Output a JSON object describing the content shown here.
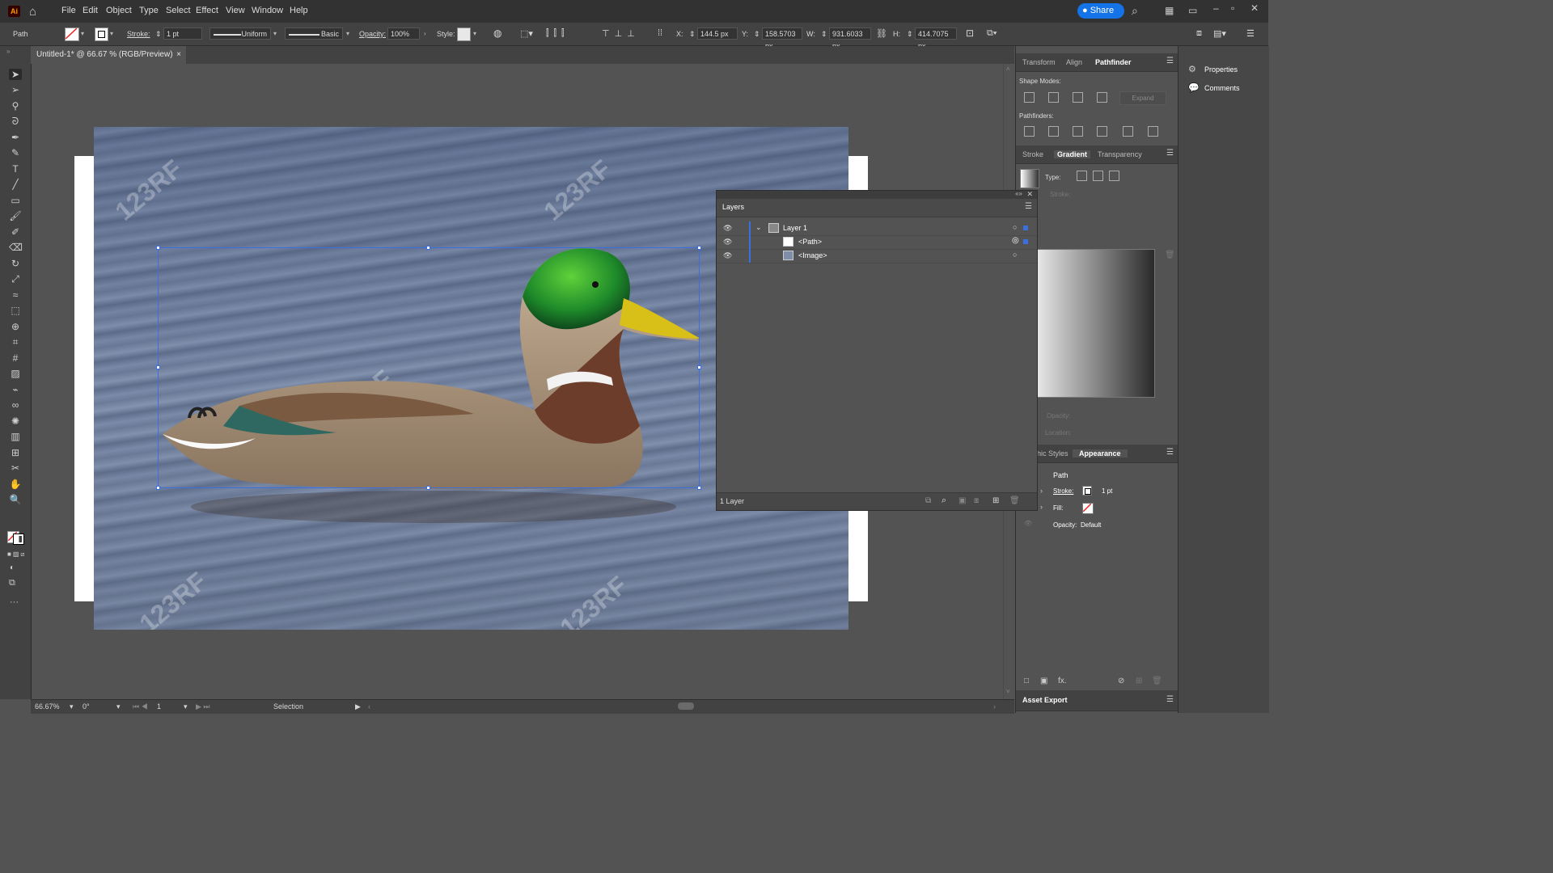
{
  "app": {
    "logo": "Ai"
  },
  "menu": [
    "File",
    "Edit",
    "Object",
    "Type",
    "Select",
    "Effect",
    "View",
    "Window",
    "Help"
  ],
  "share_label": "Share",
  "control": {
    "selection_type": "Path",
    "stroke_label": "Stroke:",
    "stroke_weight": "1 pt",
    "profile": "Uniform",
    "brush": "Basic",
    "opacity_label": "Opacity:",
    "opacity": "100%",
    "style_label": "Style:",
    "x_label": "X:",
    "x": "144.5 px",
    "y_label": "Y:",
    "y": "158.5703 px",
    "w_label": "W:",
    "w": "931.6033 px",
    "h_label": "H:",
    "h": "414.7075 px"
  },
  "document": {
    "tab_title": "Untitled-1* @ 66.67 % (RGB/Preview)"
  },
  "watermark": "123RF",
  "layers": {
    "title": "Layers",
    "rows": [
      {
        "name": "Layer 1",
        "indent": 0,
        "expanded": true
      },
      {
        "name": "<Path>",
        "indent": 1,
        "selected": true
      },
      {
        "name": "<Image>",
        "indent": 1
      }
    ],
    "footer": "1 Layer"
  },
  "pathfinder_panel": {
    "tabs": [
      "Transform",
      "Align",
      "Pathfinder"
    ],
    "active_tab": "Pathfinder",
    "shape_modes_label": "Shape Modes:",
    "expand_label": "Expand",
    "pathfinders_label": "Pathfinders:"
  },
  "gradient_panel": {
    "tabs": [
      "Stroke",
      "Gradient",
      "Transparency"
    ],
    "active_tab": "Gradient",
    "type_label": "Type:",
    "stroke_label": "Stroke:",
    "opacity_label": "Opacity:",
    "location_label": "Location:"
  },
  "appearance_panel": {
    "tabs": [
      "hic Styles",
      "Appearance"
    ],
    "active_tab": "Appearance",
    "object": "Path",
    "stroke_label": "Stroke:",
    "stroke_value": "1 pt",
    "fill_label": "Fill:",
    "opacity_label": "Opacity:",
    "opacity_value": "Default",
    "fx_label": "fx."
  },
  "asset_export": "Asset Export",
  "side_panel": {
    "properties": "Properties",
    "comments": "Comments"
  },
  "status": {
    "zoom": "66.67%",
    "rotation": "0°",
    "artboard": "1",
    "tool": "Selection"
  },
  "colors": {
    "accent": "#1473e6",
    "selection": "#3b6fe0",
    "panel": "#535353",
    "chrome": "#323232"
  }
}
